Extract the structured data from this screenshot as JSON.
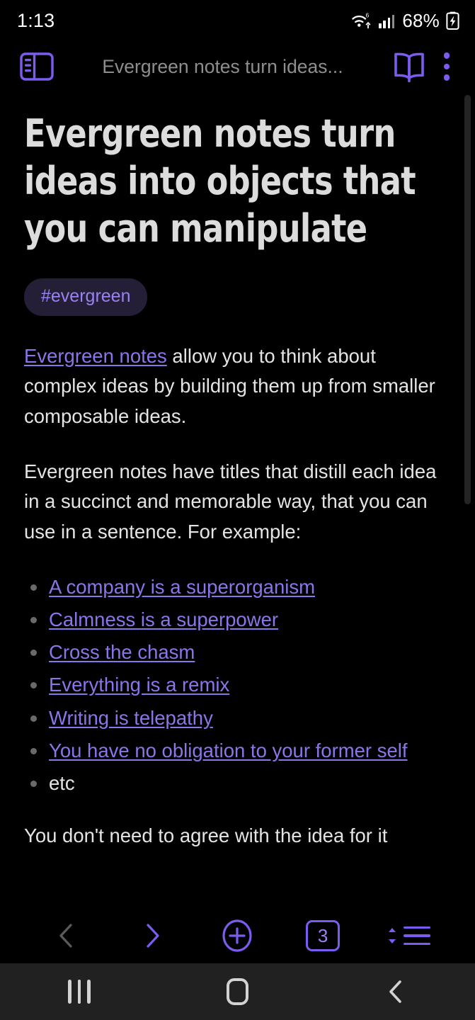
{
  "status_bar": {
    "clock": "1:13",
    "wifi_icon": "wifi-6-upload-icon",
    "wifi_generation_label": "6",
    "signal_icon": "cellular-signal-icon",
    "battery_percent": "68%",
    "battery_icon": "battery-charging-icon"
  },
  "toolbar": {
    "sidebar_toggle_icon": "sidebar-panel-icon",
    "title": "Evergreen notes turn ideas...",
    "reader_icon": "open-book-icon",
    "more_icon": "more-vertical-icon"
  },
  "note": {
    "title": "Evergreen notes turn ideas into objects that you can manipulate",
    "tag": "#evergreen",
    "paragraph_1": {
      "link": "Evergreen notes",
      "rest": " allow you to think about complex ideas by building them up from smaller composable ideas."
    },
    "paragraph_2": "Evergreen notes have titles that distill each idea in a succinct and memorable way, that you can use in a sentence. For example:",
    "bullets": [
      {
        "text": "A company is a superorganism",
        "is_link": true
      },
      {
        "text": "Calmness is a superpower",
        "is_link": true
      },
      {
        "text": "Cross the chasm",
        "is_link": true
      },
      {
        "text": "Everything is a remix",
        "is_link": true
      },
      {
        "text": "Writing is telepathy",
        "is_link": true
      },
      {
        "text": "You have no obligation to your former self",
        "is_link": true
      },
      {
        "text": "etc",
        "is_link": false
      }
    ],
    "paragraph_3_clipped": "You don't need to agree with the idea for it"
  },
  "bottom_bar": {
    "back_icon": "chevron-left-icon",
    "forward_icon": "chevron-right-icon",
    "new_tab_icon": "plus-circle-icon",
    "tab_count": "3",
    "menu_icon": "sort-list-icon"
  },
  "nav_bar": {
    "recents_icon": "recents-icon",
    "home_icon": "home-icon",
    "back_icon": "android-back-icon"
  },
  "colors": {
    "background": "#000000",
    "accent_purple": "#7c5cf0",
    "link_purple": "#8b75e8",
    "tag_bg": "#241e36",
    "tag_text": "#9b82f3",
    "body_text": "#e4e4e4",
    "title_text": "#dcdcdc",
    "toolbar_title_text": "#8e8e8e",
    "disabled_gray": "#5a5a5a",
    "navbar_bg": "#212121",
    "navbar_icon": "#d2d2d2",
    "scrollbar": "#242424"
  }
}
